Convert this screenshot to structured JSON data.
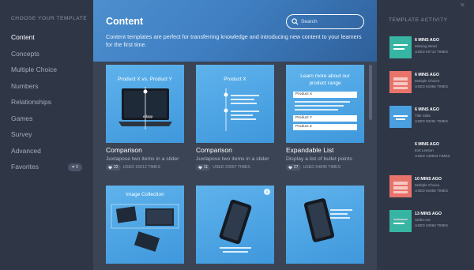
{
  "sidebar": {
    "heading": "CHOOSE YOUR TEMPLATE",
    "items": [
      {
        "label": "Content"
      },
      {
        "label": "Concepts"
      },
      {
        "label": "Multiple Choice"
      },
      {
        "label": "Numbers"
      },
      {
        "label": "Relationships"
      },
      {
        "label": "Games"
      },
      {
        "label": "Survey"
      },
      {
        "label": "Advanced"
      },
      {
        "label": "Favorites",
        "badge": "0"
      }
    ]
  },
  "header": {
    "title": "Content",
    "description": "Content templates are perfect for transferring knowledge and introducing new content to your learners for the first time.",
    "search_placeholder": "Search"
  },
  "cards": [
    {
      "title": "Comparison",
      "description": "Juxtapose two items in a slider",
      "count": "22",
      "used": "USED 16612 TIMES",
      "thumb_title": "Product X vs. Product Y",
      "thumb_brand": "edapp"
    },
    {
      "title": "Comparison",
      "description": "Juxtapose two items in a slider",
      "count": "11",
      "used": "USED 23997 TIMES",
      "thumb_title": "Product X"
    },
    {
      "title": "Expandable List",
      "description": "Display a list of bullet points",
      "count": "27",
      "used": "USED 54846 TIMES",
      "thumb_title": "Learn more about our product range",
      "list_items": [
        "Product X",
        "Product Y",
        "Product Z"
      ]
    },
    {
      "thumb_title": "Image Collection",
      "thumb_brand": "edapp"
    },
    {},
    {}
  ],
  "activity": {
    "heading": "TEMPLATE ACTIVITY",
    "items": [
      {
        "time": "6 MINS AGO",
        "name": "Missing Word",
        "used": "USED 92712 TIMES",
        "color": "#37b5a3"
      },
      {
        "time": "6 MINS AGO",
        "name": "Multiple Choice",
        "used": "USED 61956 TIMES",
        "color": "#e8736b"
      },
      {
        "time": "6 MINS AGO",
        "name": "Title Slide",
        "used": "USED 93291 TIMES",
        "color": "#4a9fdf"
      },
      {
        "time": "6 MINS AGO",
        "name": "Exit Lesson",
        "used": "USED 149534 TIMES",
        "color": "#2f3747"
      },
      {
        "time": "10 MINS AGO",
        "name": "Multiple Choice",
        "used": "USED 61956 TIMES",
        "color": "#e8736b"
      },
      {
        "time": "13 MINS AGO",
        "name": "Strike-out",
        "used": "USED 32864 TIMES",
        "color": "#37b5a3"
      }
    ]
  },
  "colors": {
    "accent_blue": "#4a9fdf",
    "teal": "#37b5a3",
    "coral": "#e8736b"
  }
}
